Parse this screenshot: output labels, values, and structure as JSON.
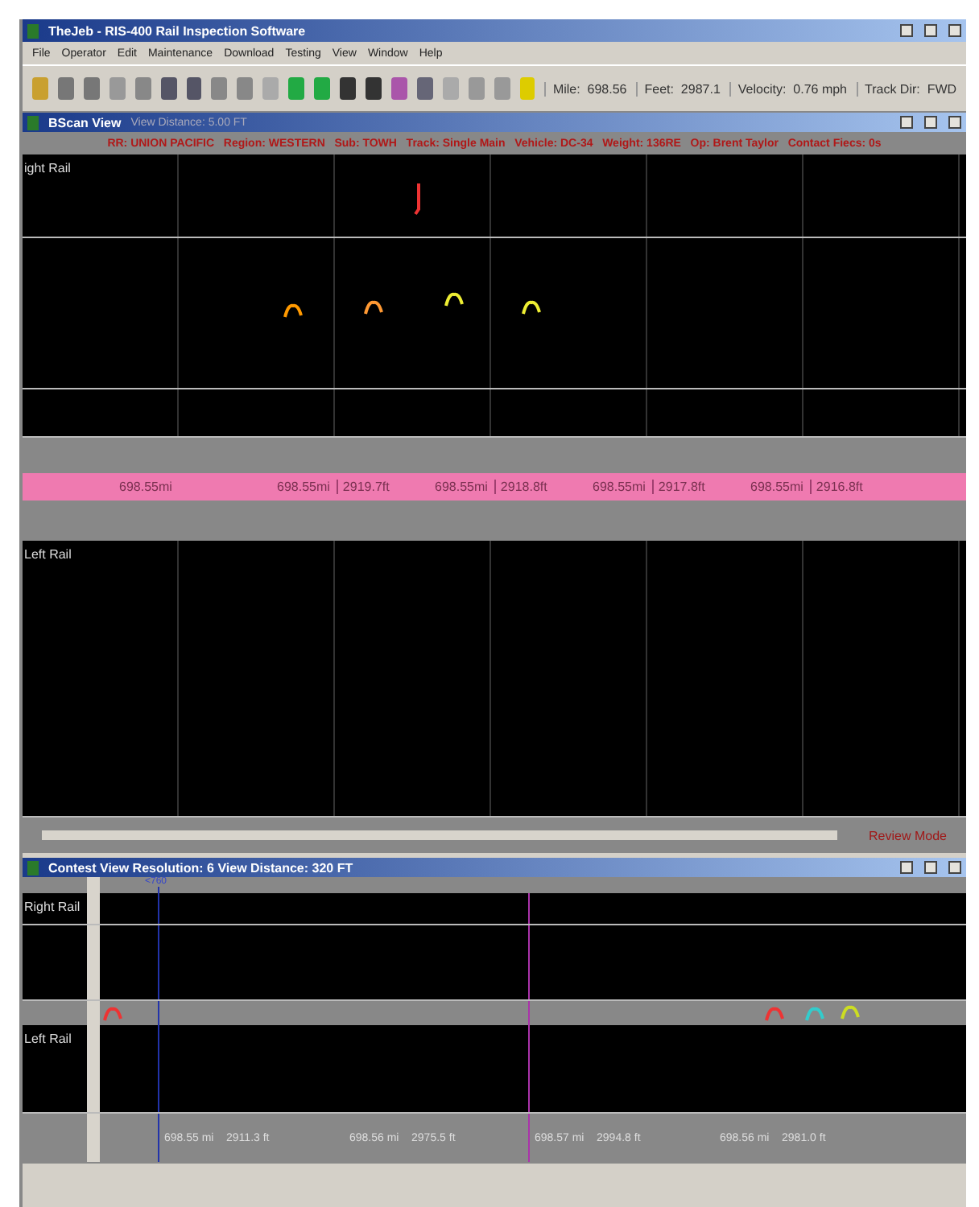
{
  "window": {
    "title": "TheJeb - RIS-400 Rail Inspection Software"
  },
  "menu": [
    "File",
    "Operator",
    "Edit",
    "Maintenance",
    "Download",
    "Testing",
    "View",
    "Window",
    "Help"
  ],
  "toolbar": {
    "readouts": [
      "Mile:  698.56",
      "Feet:  2987.1",
      "Velocity:  0.76 mph",
      "Track Dir:  FWD"
    ]
  },
  "bscan": {
    "title": "BScan View",
    "distance": "View Distance: 5.00 FT",
    "info": "RR: UNION PACIFIC   Region: WESTERN   Sub: TOWH   Track: Single Main   Vehicle: DC-34   Weight: 136RE   Op: Brent Taylor   Contact Fiecs: 0s",
    "right_label": "ight Rail",
    "left_label": "Left Rail",
    "positions": [
      {
        "mile": "698.55mi"
      },
      {
        "mile": "698.55mi",
        "feet": "2919.7ft"
      },
      {
        "mile": "698.55mi",
        "feet": "2918.8ft"
      },
      {
        "mile": "698.55mi",
        "feet": "2917.8ft"
      },
      {
        "mile": "698.55mi",
        "feet": "2916.8ft"
      }
    ],
    "mode": "Review Mode"
  },
  "contest": {
    "title": "Contest View  Resolution: 6  View Distance: 320 FT",
    "marker": "<760",
    "right_label": "Right Rail",
    "left_label": "Left Rail",
    "positions": [
      "698.55 mi    2911.3 ft",
      "698.56 mi    2975.5 ft",
      "698.57 mi    2994.8 ft",
      "698.56 mi    2981.0 ft"
    ]
  }
}
